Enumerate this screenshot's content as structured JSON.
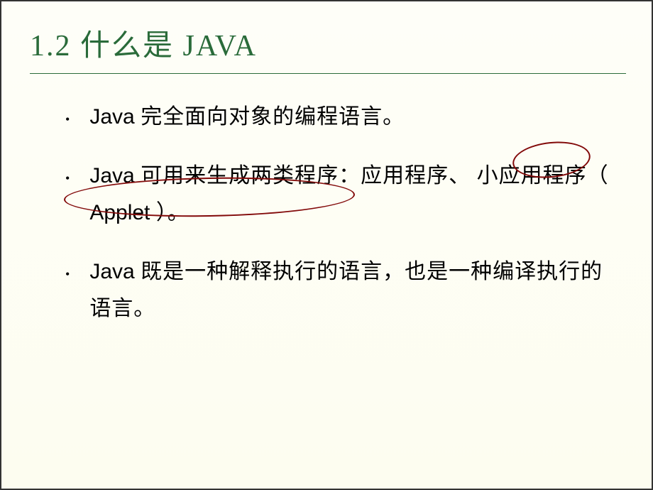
{
  "slide": {
    "title": "1.2 什么是 JAVA",
    "bullets": [
      {
        "prefix": "Java",
        "rest": " 完全面向对象的编程语言。"
      },
      {
        "prefix": "Java",
        "rest_part1": " 可用来生成两类程序：应用程序、 小应用程序（ ",
        "applet": "Applet",
        "rest_part2": " ）。"
      },
      {
        "prefix": "Java",
        "rest": " 既是一种解释执行的语言，也是一种编译执行的语言。"
      }
    ]
  }
}
